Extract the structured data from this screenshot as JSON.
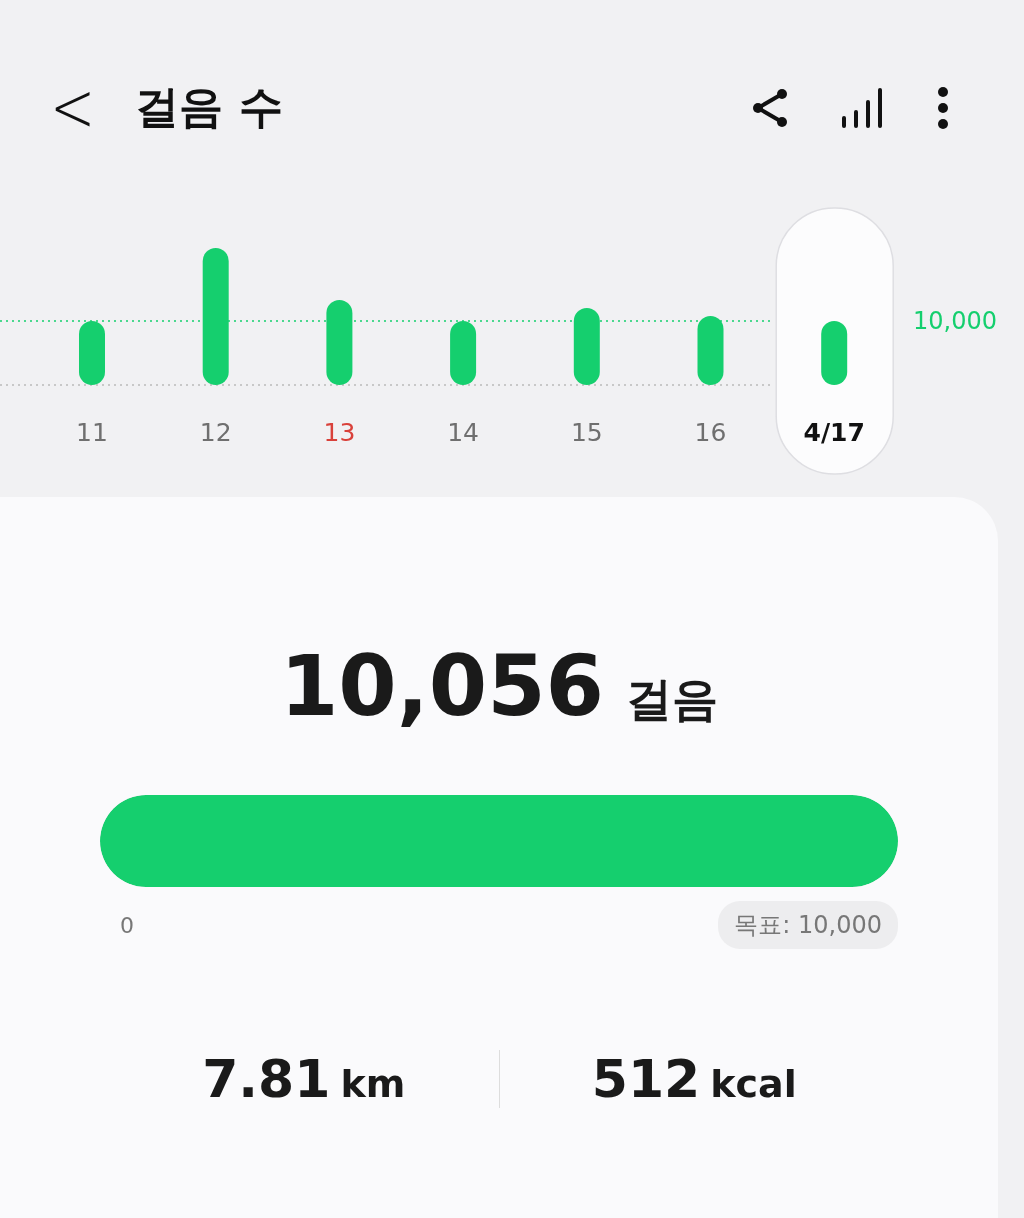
{
  "header": {
    "back": "<",
    "title": "걸음 수"
  },
  "chart": {
    "goal_label": "10,000",
    "days": [
      {
        "label": "11",
        "selected": false,
        "color": "#6f6f6f"
      },
      {
        "label": "12",
        "selected": false,
        "color": "#6f6f6f"
      },
      {
        "label": "13",
        "selected": false,
        "color": "#d9413a"
      },
      {
        "label": "14",
        "selected": false,
        "color": "#6f6f6f"
      },
      {
        "label": "15",
        "selected": false,
        "color": "#6f6f6f"
      },
      {
        "label": "16",
        "selected": false,
        "color": "#6f6f6f"
      },
      {
        "label": "4/17",
        "selected": true,
        "color": "#111111"
      }
    ]
  },
  "summary": {
    "steps": "10,056",
    "unit": "걸음",
    "level": 1,
    "min_label": "0",
    "goal": "목표: 10,000"
  },
  "stats": [
    {
      "value": "7.81",
      "unit": "km"
    },
    {
      "value": "512",
      "unit": "kcal"
    }
  ]
}
